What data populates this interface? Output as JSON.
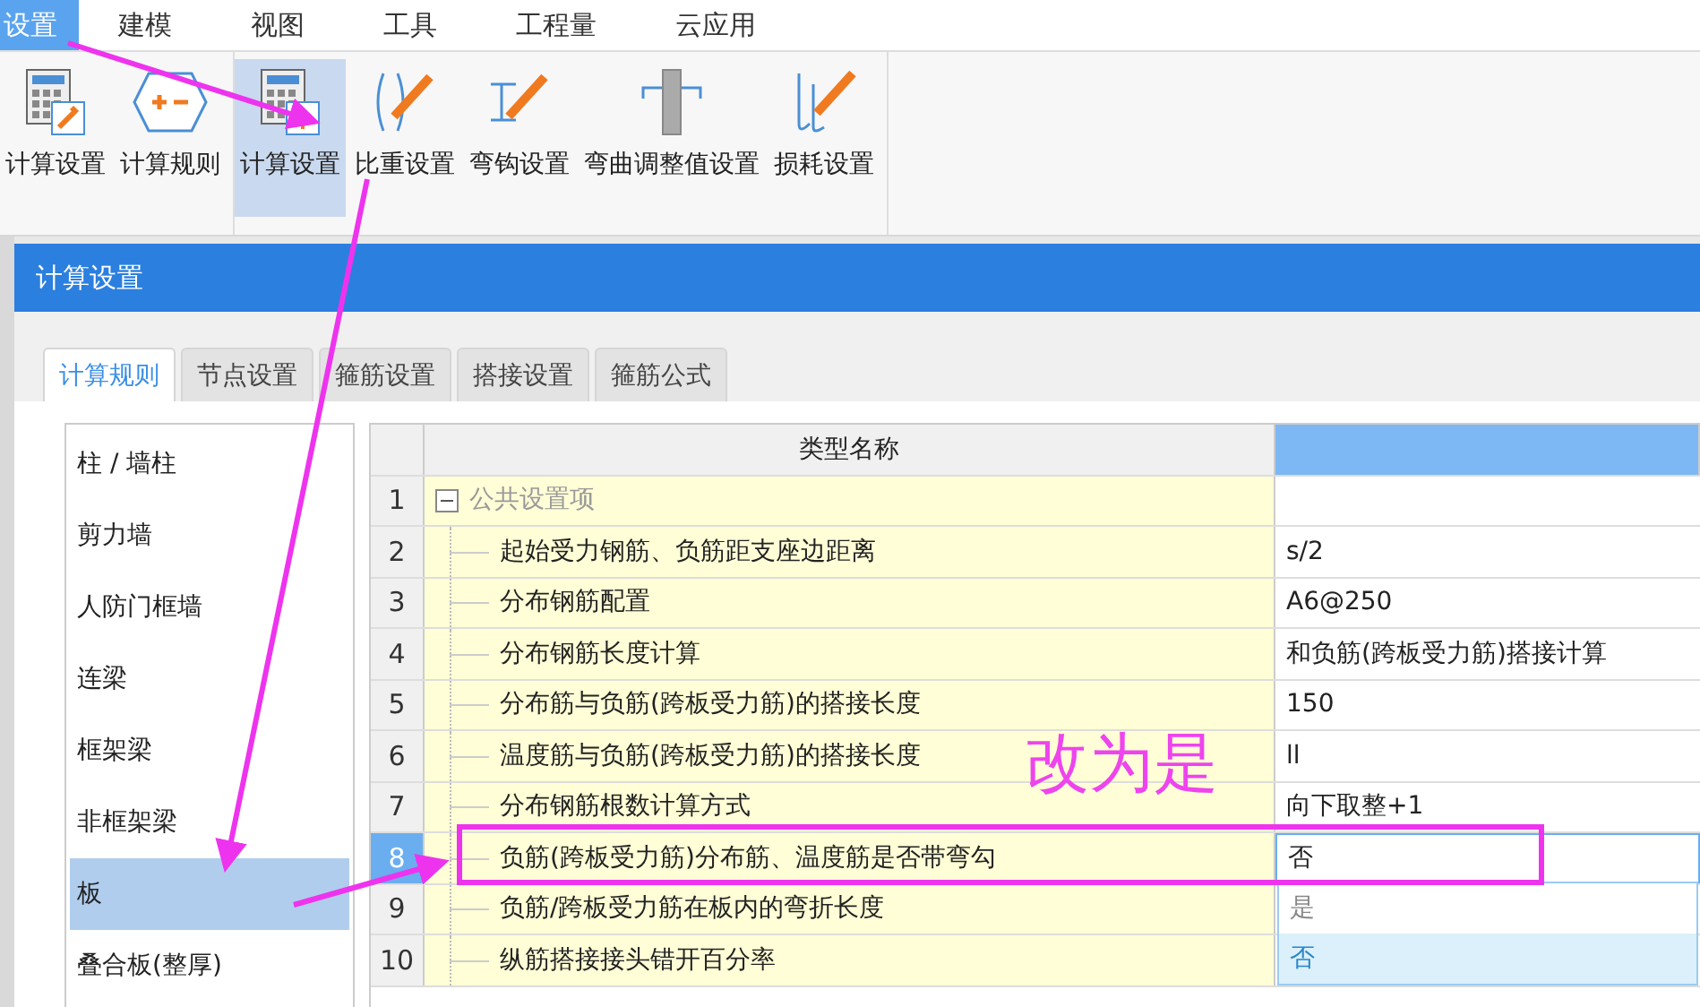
{
  "menu": [
    {
      "label": "设置",
      "selected": true
    },
    {
      "label": "建模",
      "selected": false
    },
    {
      "label": "视图",
      "selected": false
    },
    {
      "label": "工具",
      "selected": false
    },
    {
      "label": "工程量",
      "selected": false
    },
    {
      "label": "云应用",
      "selected": false
    }
  ],
  "ribbon": {
    "groups": [
      [
        {
          "label": "计算设置",
          "selected": false
        },
        {
          "label": "计算规则",
          "selected": false
        }
      ],
      [
        {
          "label": "计算设置",
          "selected": true
        },
        {
          "label": "比重设置",
          "selected": false
        },
        {
          "label": "弯钩设置",
          "selected": false
        },
        {
          "label": "弯曲调整值设置",
          "selected": false
        },
        {
          "label": "损耗设置",
          "selected": false
        }
      ]
    ]
  },
  "dialog": {
    "title": "计算设置",
    "tabs": [
      {
        "label": "计算规则",
        "selected": true
      },
      {
        "label": "节点设置",
        "selected": false
      },
      {
        "label": "箍筋设置",
        "selected": false
      },
      {
        "label": "搭接设置",
        "selected": false
      },
      {
        "label": "箍筋公式",
        "selected": false
      }
    ],
    "categories": [
      {
        "label": "柱 / 墙柱",
        "selected": false
      },
      {
        "label": "剪力墙",
        "selected": false
      },
      {
        "label": "人防门框墙",
        "selected": false
      },
      {
        "label": "连梁",
        "selected": false
      },
      {
        "label": "框架梁",
        "selected": false
      },
      {
        "label": "非框架梁",
        "selected": false
      },
      {
        "label": "板",
        "selected": true
      },
      {
        "label": "叠合板(整厚)",
        "selected": false
      }
    ],
    "table": {
      "columns": [
        "类型名称"
      ],
      "rows": [
        {
          "num": "1",
          "kind": "group",
          "name": "公共设置项",
          "expanded": true,
          "selected": false
        },
        {
          "num": "2",
          "kind": "item",
          "name": "起始受力钢筋、负筋距支座边距离",
          "value": "s/2",
          "selected": false
        },
        {
          "num": "3",
          "kind": "item",
          "name": "分布钢筋配置",
          "value": "A6@250",
          "selected": false
        },
        {
          "num": "4",
          "kind": "item",
          "name": "分布钢筋长度计算",
          "value": "和负筋(跨板受力筋)搭接计算",
          "selected": false
        },
        {
          "num": "5",
          "kind": "item",
          "name": "分布筋与负筋(跨板受力筋)的搭接长度",
          "value": "150",
          "selected": false
        },
        {
          "num": "6",
          "kind": "item",
          "name": "温度筋与负筋(跨板受力筋)的搭接长度",
          "value": "ll",
          "selected": false
        },
        {
          "num": "7",
          "kind": "item",
          "name": "分布钢筋根数计算方式",
          "value": "向下取整+1",
          "selected": false
        },
        {
          "num": "8",
          "kind": "item",
          "name": "负筋(跨板受力筋)分布筋、温度筋是否带弯勾",
          "value": "否",
          "selected": true
        },
        {
          "num": "9",
          "kind": "item",
          "name": "负筋/跨板受力筋在板内的弯折长度",
          "selected": false
        },
        {
          "num": "10",
          "kind": "item",
          "name": "纵筋搭接接头错开百分率",
          "selected": false
        }
      ],
      "dropdown": [
        {
          "label": "是",
          "selected": false
        },
        {
          "label": "否",
          "selected": true
        }
      ]
    }
  },
  "annotation": {
    "note": "改为是"
  }
}
